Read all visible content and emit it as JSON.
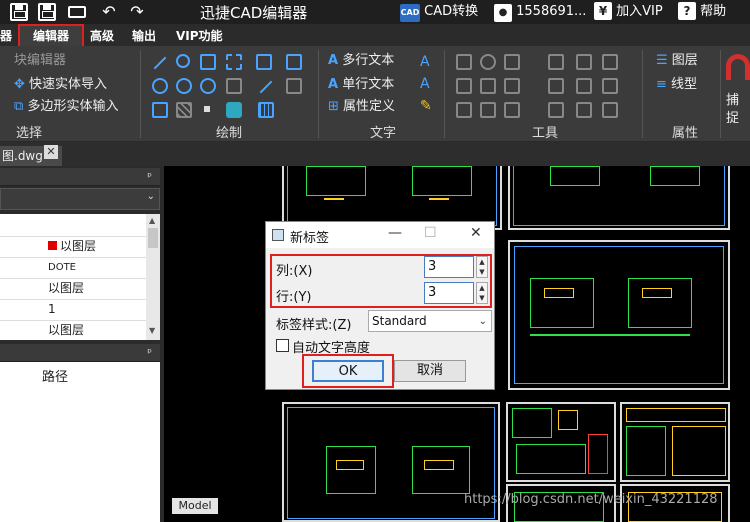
{
  "titlebar": {
    "app_title": "迅捷CAD编辑器",
    "cad_convert": "CAD转换",
    "cad_badge": "CAD",
    "phone": "1558691...",
    "vip_join": "加入VIP",
    "help": "帮助",
    "yen_glyph": "¥",
    "help_glyph": "?",
    "undo_glyph": "↶",
    "redo_glyph": "↷"
  },
  "tabs": {
    "t0": "器",
    "editor": "编辑器",
    "advanced": "高级",
    "output": "输出",
    "vip": "VIP功能"
  },
  "ribbon": {
    "select": {
      "item_top": "块编辑器",
      "quick_import": "快速实体导入",
      "polygon_input": "多边形实体输入",
      "label": "选择"
    },
    "draw": {
      "label": "绘制"
    },
    "text": {
      "mtext": "多行文本",
      "stext": "单行文本",
      "attr_def": "属性定义",
      "label": "文字"
    },
    "tools": {
      "label": "工具"
    },
    "props": {
      "layer": "图层",
      "linetype": "线型",
      "label": "属性"
    },
    "capture": "捕捉"
  },
  "filetab": {
    "name": "图.dwg",
    "close": "✕"
  },
  "leftpanel": {
    "pin": "ᵖ",
    "rows": [
      "以图层",
      "DOTE",
      "以图层",
      "1",
      "以图层"
    ],
    "path_header": "路径"
  },
  "canvas": {
    "model_tab": "Model",
    "watermark": "https://blog.csdn.net/weixin_43221128"
  },
  "dialog": {
    "title": "新标签",
    "min": "—",
    "max": "☐",
    "close": "✕",
    "col_label": "列:(X)",
    "col_value": "3",
    "row_label": "行:(Y)",
    "row_value": "3",
    "style_label": "标签样式:(Z)",
    "style_value": "Standard",
    "auto_height": "自动文字高度",
    "ok": "OK",
    "cancel": "取消"
  },
  "colors": {
    "accent_red": "#e02020",
    "cad_green": "#2ee04a",
    "ribbon_blue": "#4aa3ff"
  }
}
